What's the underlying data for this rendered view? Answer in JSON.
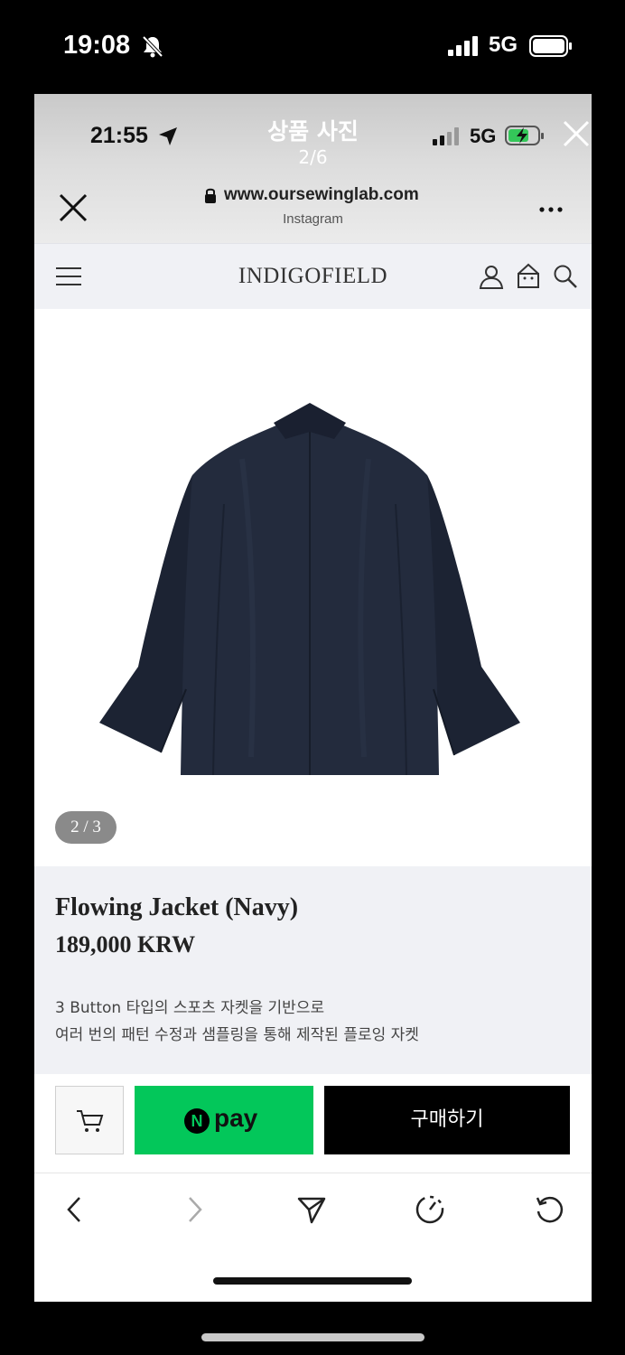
{
  "outer_status": {
    "time": "19:08",
    "network": "5G",
    "icons": [
      "bell-slash-icon",
      "signal-bars-icon",
      "battery-icon"
    ]
  },
  "viewer": {
    "title": "상품 사진",
    "counter": "2/6",
    "inner_time": "21:55",
    "inner_network": "5G",
    "icons": [
      "location-arrow-icon",
      "signal-bars-icon",
      "battery-charging-icon",
      "close-icon"
    ]
  },
  "browser": {
    "url": "www.oursewinglab.com",
    "source": "Instagram",
    "icons": [
      "close-icon",
      "lock-icon",
      "more-icon"
    ]
  },
  "site": {
    "brand": "INDIGOFIELD",
    "icons": [
      "hamburger-icon",
      "user-icon",
      "shopping-bag-icon",
      "search-icon"
    ]
  },
  "product": {
    "image_counter": "2 / 3",
    "image_subject": "navy jacket back view",
    "name": "Flowing Jacket (Navy)",
    "price": "189,000 KRW",
    "description": [
      "3 Button 타입의 스포츠 자켓을 기반으로",
      "여러 번의 패턴 수정과 샘플링을 통해 제작된 플로잉 자켓"
    ]
  },
  "buy_bar": {
    "npay_badge": "N",
    "npay_label": "pay",
    "buy_label": "구매하기",
    "colors": {
      "npay": "#03c75a",
      "buy": "#000000"
    }
  },
  "toolbar": {
    "icons": [
      "back-icon",
      "forward-icon",
      "share-icon",
      "timer-icon",
      "refresh-icon"
    ]
  }
}
